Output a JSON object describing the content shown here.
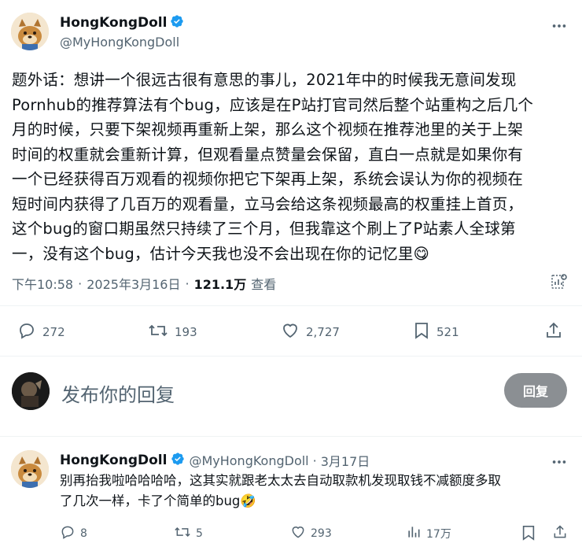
{
  "main_tweet": {
    "author_name": "HongKongDoll",
    "author_handle": "@MyHongKongDoll",
    "text_lines": [
      "题外话：想讲一个很远古很有意思的事儿，2021年中的时候我无意间发现",
      "Pornhub的推荐算法有个bug，应该是在P站打官司然后整个站重构之后几个",
      "月的时候，只要下架视频再重新上架，那么这个视频在推荐池里的关于上架",
      "时间的权重就会重新计算，但观看量点赞量会保留，直白一点就是如果你有",
      "一个已经获得百万观看的视频你把它下架再上架，系统会误认为你的视频在",
      "短时间内获得了几百万的观看量，立马会给这条视频最高的权重挂上首页，",
      "这个bug的窗口期虽然只持续了三个月，但我靠这个刷上了P站素人全球第",
      "一，没有这个bug，估计今天我也没不会出现在你的记忆里😋"
    ],
    "time": "下午10:58",
    "date": "2025年3月16日",
    "views_count": "121.1万",
    "views_label": "查看",
    "replies": "272",
    "retweets": "193",
    "likes": "2,727",
    "bookmarks": "521"
  },
  "compose": {
    "placeholder": "发布你的回复",
    "button_label": "回复"
  },
  "reply_tweet": {
    "author_name": "HongKongDoll",
    "author_handle": "@MyHongKongDoll",
    "separator": "·",
    "date": "3月17日",
    "text_lines": [
      "别再抬我啦哈哈哈哈，这其实就跟老太太去自动取款机发现取钱不减额度多取",
      "了几次一样，卡了个简单的bug🤣"
    ],
    "replies": "8",
    "retweets": "5",
    "likes": "293",
    "views": "17万"
  },
  "colors": {
    "verified": "#1d9bf0",
    "secondary_text": "#536471",
    "reply_button_bg": "#8b8f93"
  },
  "icons": {
    "verified": "verified-badge-icon",
    "more": "more-icon",
    "reply": "reply-icon",
    "retweet": "retweet-icon",
    "like": "heart-icon",
    "bookmark": "bookmark-icon",
    "share": "share-icon",
    "analytics": "analytics-icon",
    "views": "views-icon"
  }
}
